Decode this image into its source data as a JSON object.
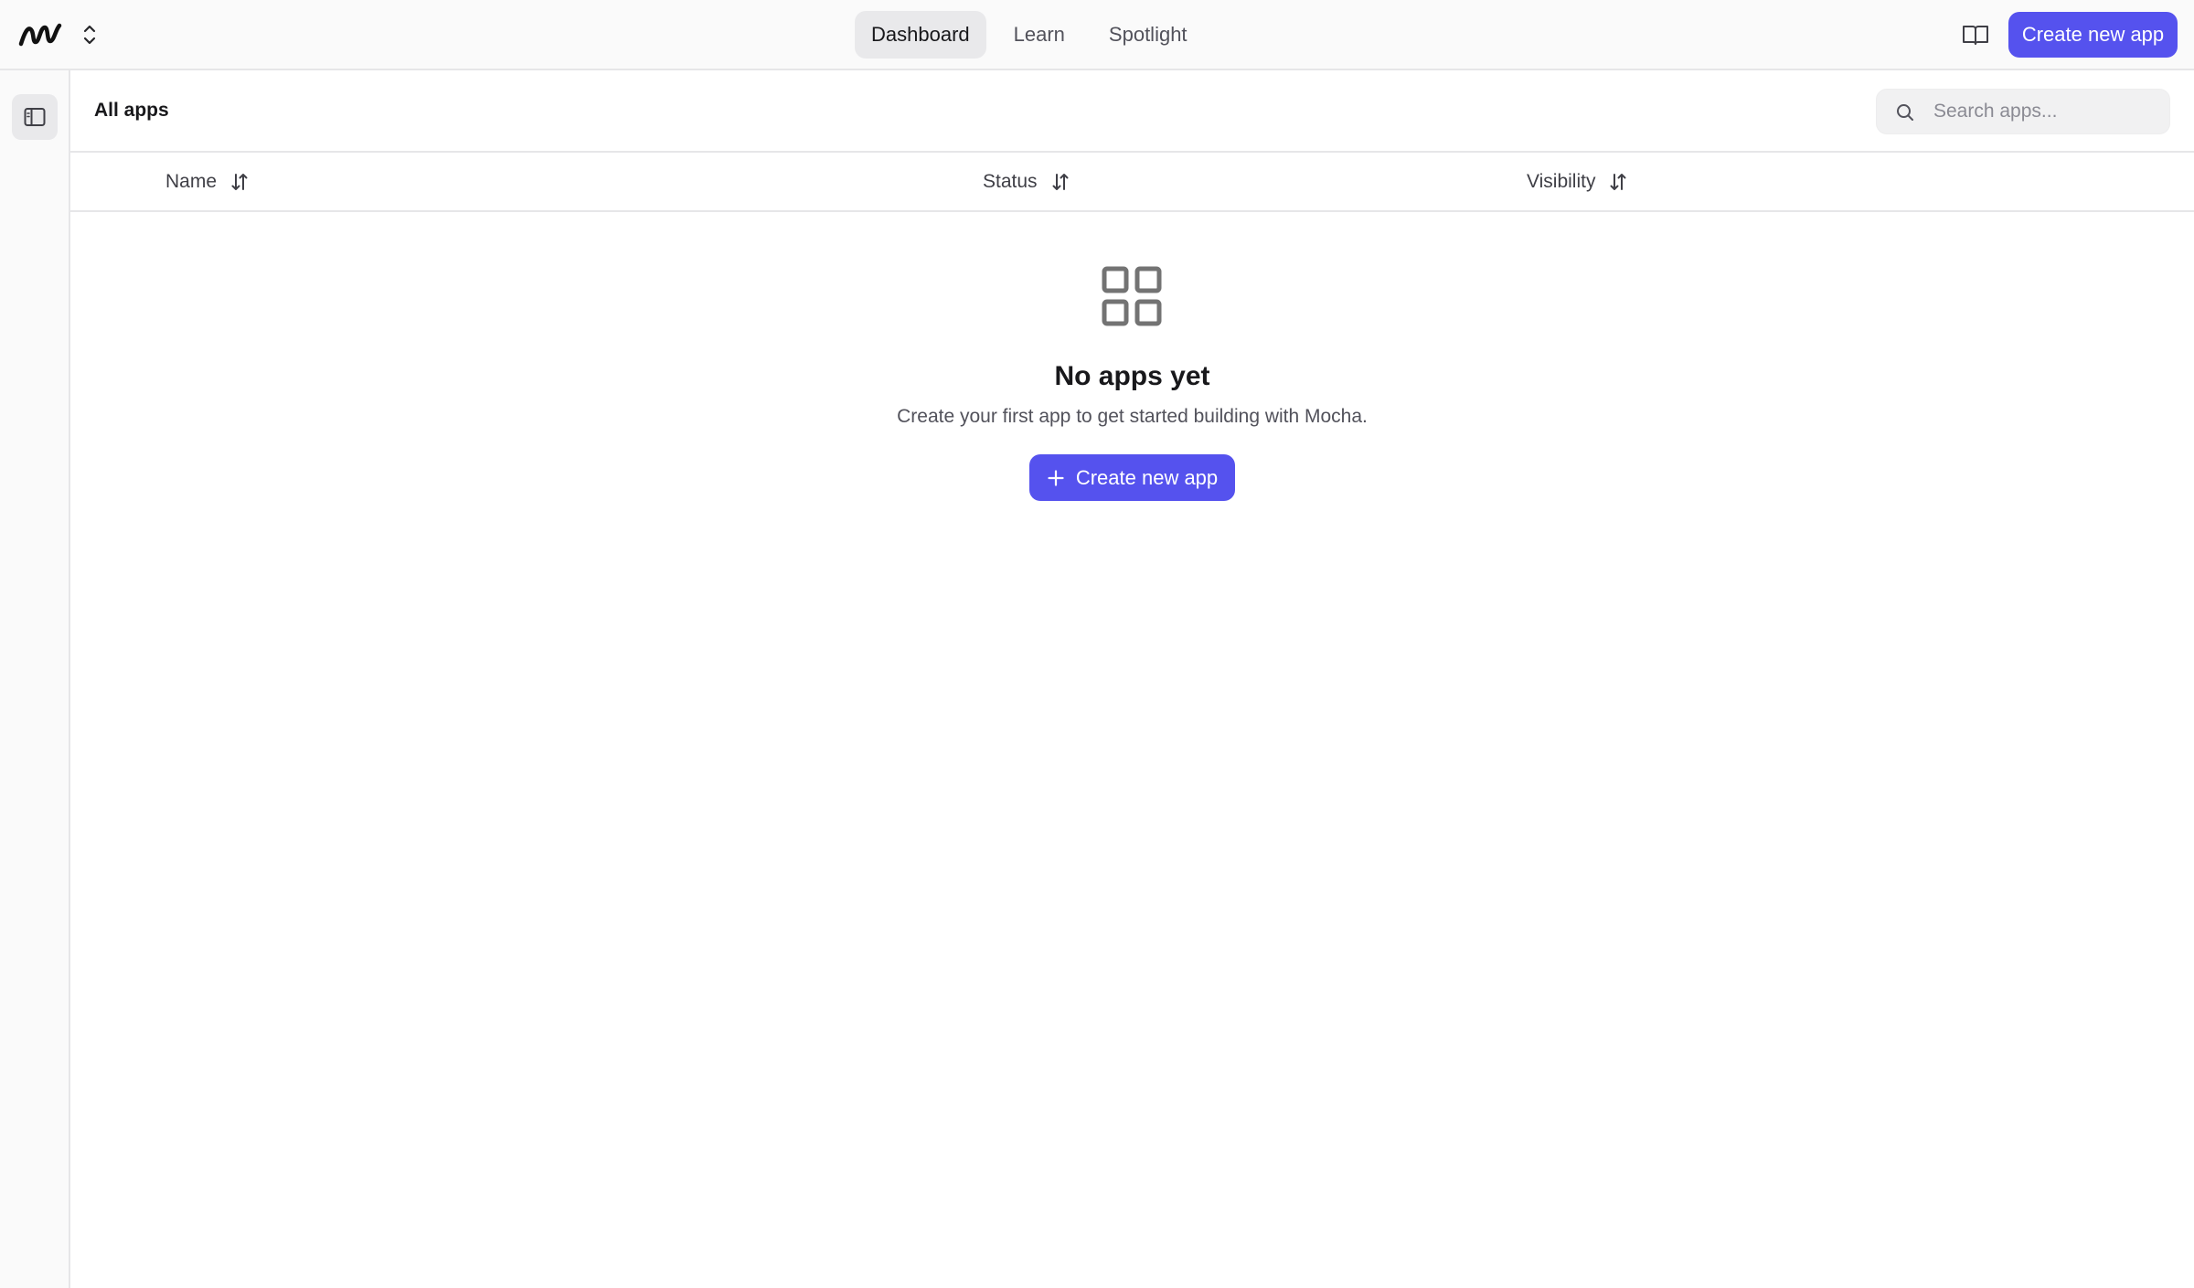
{
  "app": {
    "brand_icon": "mocha-logo-icon",
    "switcher_icon": "chevron-up-down-icon"
  },
  "nav": {
    "tabs": [
      {
        "label": "Dashboard",
        "active": true
      },
      {
        "label": "Learn",
        "active": false
      },
      {
        "label": "Spotlight",
        "active": false
      }
    ]
  },
  "header_actions": {
    "docs_icon": "book-open-icon",
    "create_label": "Create new app"
  },
  "sidebar": {
    "toggle_icon": "sidebar-panel-icon"
  },
  "main": {
    "title": "All apps",
    "search": {
      "placeholder": "Search apps...",
      "value": "",
      "icon": "search-icon"
    },
    "columns": [
      {
        "label": "Name",
        "sort_icon": "sort-arrows-icon"
      },
      {
        "label": "Status",
        "sort_icon": "sort-arrows-icon"
      },
      {
        "label": "Visibility",
        "sort_icon": "sort-arrows-icon"
      }
    ],
    "rows": [],
    "empty_state": {
      "icon": "grid-apps-icon",
      "title": "No apps yet",
      "subtitle": "Create your first app to get started building with Mocha.",
      "button_label": "Create new app",
      "button_icon": "plus-icon"
    }
  },
  "colors": {
    "accent": "#5552ee",
    "background": "#fafafa",
    "surface": "#ffffff",
    "border": "#e6e6e8",
    "muted_text": "#52525b"
  }
}
